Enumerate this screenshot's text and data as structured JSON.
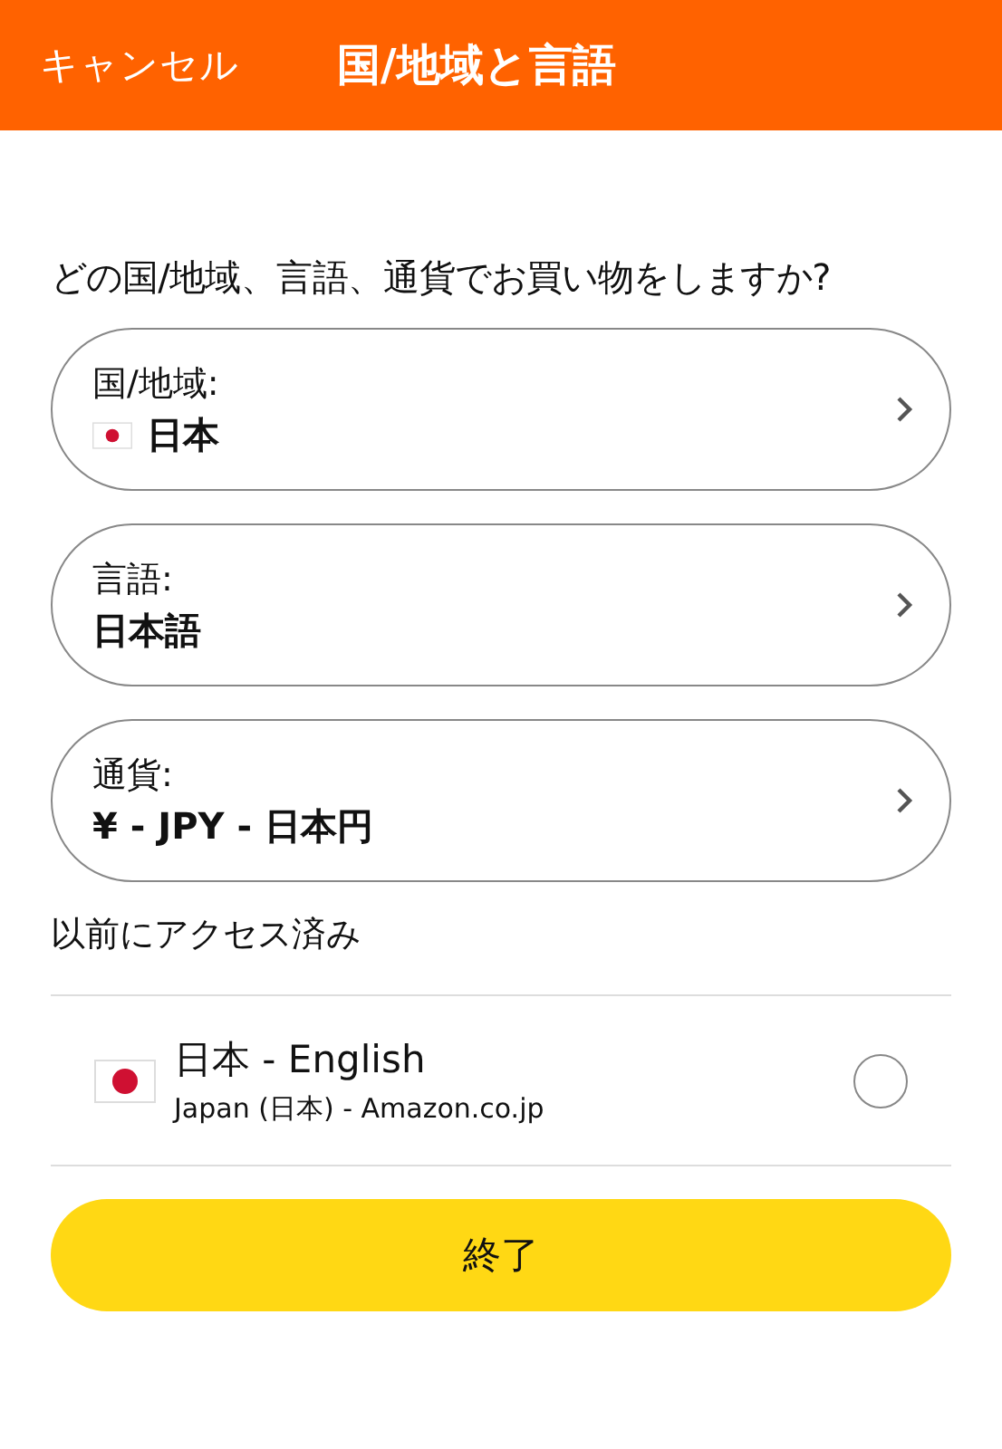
{
  "header": {
    "cancel": "キャンセル",
    "title": "国/地域と言語"
  },
  "question": "どの国/地域、言語、通貨でお買い物をしますか?",
  "selectors": [
    {
      "kind": "flag",
      "label": "国/地域:",
      "value": "日本"
    },
    {
      "kind": "plain",
      "label": "言語:",
      "value": "日本語"
    },
    {
      "kind": "plain",
      "label": "通貨:",
      "value": "¥ - JPY - 日本円"
    }
  ],
  "recent": {
    "heading": "以前にアクセス済み",
    "items": [
      {
        "title": "日本 - English",
        "subtitle": "Japan (日本) - Amazon.co.jp",
        "selected": false
      }
    ]
  },
  "done_button": "終了"
}
